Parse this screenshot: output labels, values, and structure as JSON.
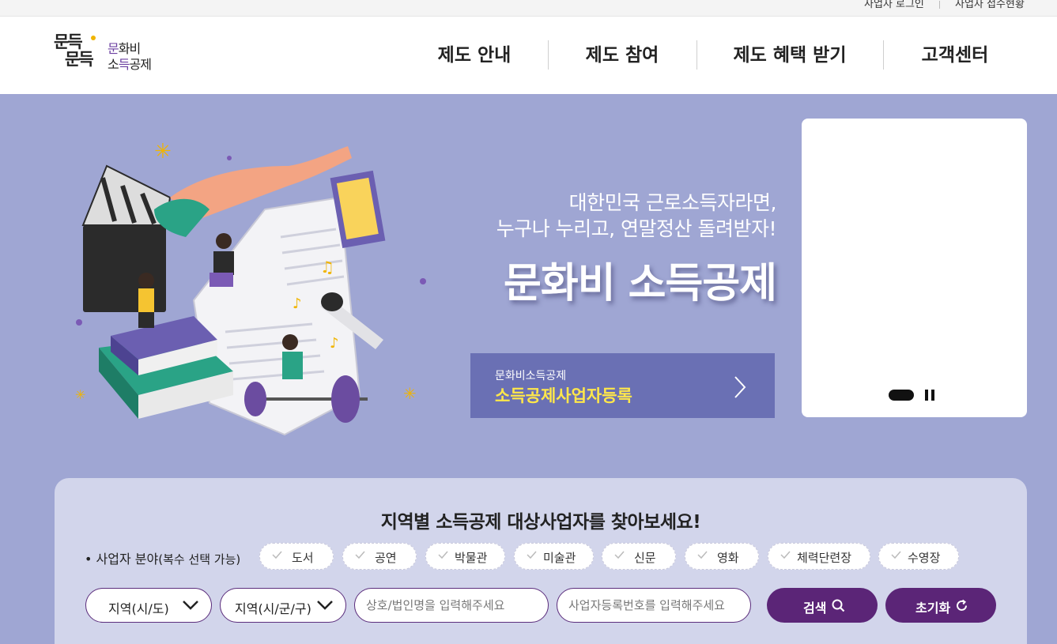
{
  "util": {
    "login": "사업자 로그인",
    "apply": "사업자 접수현황"
  },
  "logo": {
    "big1": "문득",
    "big2": "문득",
    "small1_a": "문",
    "small1_b": "화비",
    "small2_a": "소",
    "small2_b": "득",
    "small2_c": "공제"
  },
  "nav": [
    "제도 안내",
    "제도 참여",
    "제도 혜택 받기",
    "고객센터"
  ],
  "hero": {
    "sub1": "대한민국 근로소득자라면,",
    "sub2": "누구나 누리고, 연말정산 돌려받자!",
    "title": "문화비 소득공제",
    "register_small": "문화비소득공제",
    "register_big": "소득공제사업자등록"
  },
  "search": {
    "title": "지역별 소득공제 대상사업자를 찾아보세요!",
    "field_label": "• 사업자 분야",
    "field_note": "(복수 선택 가능)",
    "categories": [
      "도서",
      "공연",
      "박물관",
      "미술관",
      "신문",
      "영화",
      "체력단련장",
      "수영장"
    ],
    "region1": "지역(시/도)",
    "region2": "지역(시/군/구)",
    "name_placeholder": "상호/법인명을 입력해주세요",
    "bizno_placeholder": "사업자등록번호를 입력해주세요",
    "search_label": "검색",
    "reset_label": "초기화"
  },
  "colors": {
    "hero_bg": "#9fa6d3",
    "register_bg": "#6a70b4",
    "register_accent": "#ffe74a",
    "brand_purple": "#5b2577",
    "panel_bg": "#d2d5eb"
  }
}
